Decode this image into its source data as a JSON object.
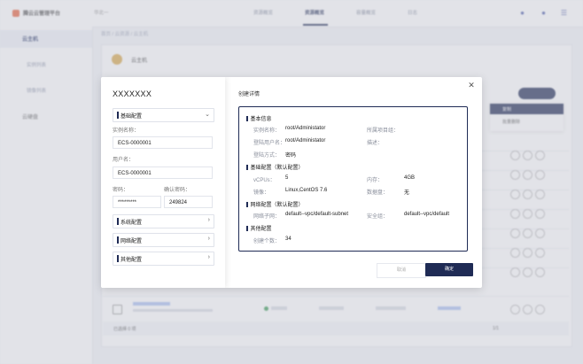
{
  "app": {
    "title": "腾云云管理平台",
    "region": "华北一",
    "nav": [
      "资源概览",
      "资源概览",
      "容量概览",
      "日志"
    ],
    "breadcrumb": "首页 / 云资源 / 云主机"
  },
  "sidebar": {
    "group1": "云主机",
    "sub1": "实例列表",
    "sub2": "镜像列表",
    "group2": "云硬盘"
  },
  "resource": {
    "name": "云主机"
  },
  "dropdown": {
    "item1": "复制",
    "item2": "批量删除"
  },
  "footer": {
    "selected": "已选择 0 项",
    "pager": "1/1"
  },
  "modal": {
    "left_title": "XXXXXXX",
    "basic_section": "基础配置",
    "instance_name_label": "实例名称：",
    "instance_name_value": "ECS-0000001",
    "username_label": "用户名：",
    "username_value": "ECS-0000001",
    "password_label": "密码：",
    "password_value": "*********",
    "confirm_password_label": "确认密码：",
    "confirm_password_value": "249824",
    "system_section": "系统配置",
    "network_section": "网络配置",
    "other_section": "其他配置",
    "right_title": "创建详情",
    "close_icon": "close-icon",
    "detail": {
      "basic_info_heading": "基本信息",
      "instance_name_key": "实例名称：",
      "instance_name_val": "root/Administator",
      "project_key": "所属项目组：",
      "login_user_key": "登陆用户名：",
      "login_user_val": "root/Administator",
      "desc_key": "描述：",
      "login_method_key": "登陆方式：",
      "login_method_val": "密码",
      "base_config_heading": "基础配置（默认配置）",
      "vcpu_key": "vCPUs：",
      "vcpu_val": "5",
      "memory_key": "内存：",
      "memory_val": "4GB",
      "image_key": "镜像：",
      "image_val": "Linux,CentOS 7.6",
      "datadisk_key": "数据盘：",
      "datadisk_val": "无",
      "network_heading": "网络配置（默认配置）",
      "subnet_key": "网络子网：",
      "subnet_val": "default--vpc/default-subnet",
      "secgroup_key": "安全组：",
      "secgroup_val": "default--vpc/default",
      "other_heading": "其他配置",
      "count_key": "创建个数：",
      "count_val": "34"
    },
    "cancel_label": "取消",
    "ok_label": "确定"
  },
  "colors": {
    "primary": "#1f2b55",
    "accent_orange": "#e8613c",
    "link": "#2f5bd8",
    "status_green": "#3a9a55"
  }
}
